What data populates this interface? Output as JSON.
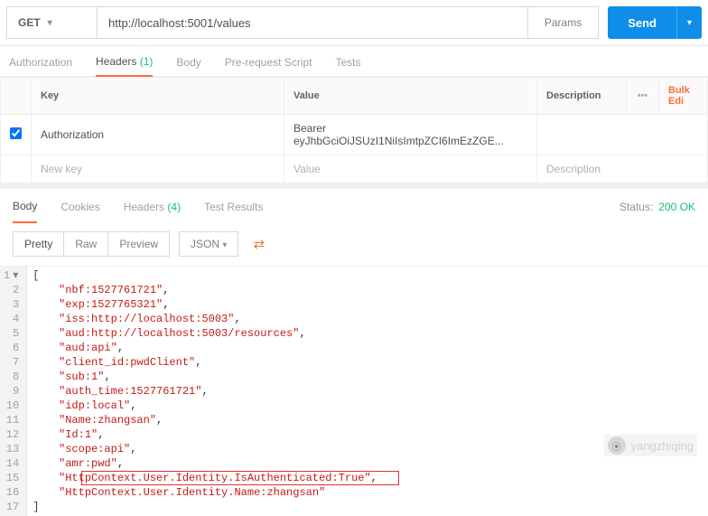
{
  "request": {
    "method": "GET",
    "url": "http://localhost:5001/values",
    "params_label": "Params",
    "send_label": "Send"
  },
  "req_tabs": {
    "authorization": "Authorization",
    "headers": "Headers",
    "headers_count": "(1)",
    "body": "Body",
    "prerequest": "Pre-request Script",
    "tests": "Tests"
  },
  "kv": {
    "key_header": "Key",
    "value_header": "Value",
    "desc_header": "Description",
    "bulk_label": "Bulk Edi",
    "dots": "•••",
    "row1_key": "Authorization",
    "row1_value": "Bearer eyJhbGciOiJSUzI1NiIsImtpZCI6ImEzZGE...",
    "new_key_ph": "New key",
    "value_ph": "Value",
    "desc_ph": "Description"
  },
  "resp_tabs": {
    "body": "Body",
    "cookies": "Cookies",
    "headers": "Headers",
    "headers_count": "(4)",
    "tests": "Test Results",
    "status_label": "Status:",
    "status_value": "200 OK"
  },
  "viewer": {
    "pretty": "Pretty",
    "raw": "Raw",
    "preview": "Preview",
    "format": "JSON"
  },
  "code": {
    "lines": [
      {
        "prefix": "",
        "text": "[",
        "cls": "tok-br",
        "fold": true
      },
      {
        "prefix": "    ",
        "text": "\"nbf:1527761721\"",
        "comma": true
      },
      {
        "prefix": "    ",
        "text": "\"exp:1527765321\"",
        "comma": true
      },
      {
        "prefix": "    ",
        "text": "\"iss:http://localhost:5003\"",
        "comma": true
      },
      {
        "prefix": "    ",
        "text": "\"aud:http://localhost:5003/resources\"",
        "comma": true
      },
      {
        "prefix": "    ",
        "text": "\"aud:api\"",
        "comma": true
      },
      {
        "prefix": "    ",
        "text": "\"client_id:pwdClient\"",
        "comma": true
      },
      {
        "prefix": "    ",
        "text": "\"sub:1\"",
        "comma": true
      },
      {
        "prefix": "    ",
        "text": "\"auth_time:1527761721\"",
        "comma": true
      },
      {
        "prefix": "    ",
        "text": "\"idp:local\"",
        "comma": true
      },
      {
        "prefix": "    ",
        "text": "\"Name:zhangsan\"",
        "comma": true
      },
      {
        "prefix": "    ",
        "text": "\"Id:1\"",
        "comma": true
      },
      {
        "prefix": "    ",
        "text": "\"scope:api\"",
        "comma": true
      },
      {
        "prefix": "    ",
        "text": "\"amr:pwd\"",
        "comma": true
      },
      {
        "prefix": "    ",
        "text": "\"HttpContext.User.Identity.IsAuthenticated:True\"",
        "comma": true
      },
      {
        "prefix": "    ",
        "text": "\"HttpContext.User.Identity.Name:zhangsan\"",
        "comma": false
      },
      {
        "prefix": "",
        "text": "]",
        "cls": "tok-br"
      }
    ]
  },
  "watermark": "yangzhiqing"
}
